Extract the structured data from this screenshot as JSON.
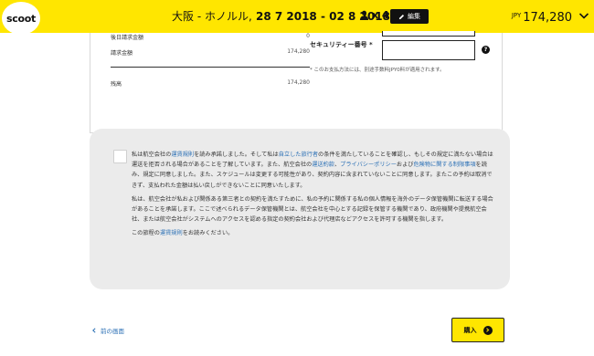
{
  "header": {
    "logo": "scoot",
    "route": "大阪 - ホノルル,",
    "dates": "28 7 2018 - 02 8 2018",
    "passengers": "x 4",
    "edit_label": "編集",
    "currency": "JPY",
    "total": "174,280",
    "bg_color": "#ffe600"
  },
  "summary": {
    "rows": [
      {
        "label": "後日請求金額",
        "value": "0"
      },
      {
        "label": "請求金額",
        "value": "174,280"
      },
      {
        "label": "残高",
        "value": "174,280"
      }
    ],
    "security_code_label": "セキュリティー番号 *",
    "security_code_value": "",
    "fee_note": "* このお支払方法には、別途手数料JPY0料が適用されます。"
  },
  "terms": {
    "p1_a": "私は航空会社の",
    "p1_link1": "運賃規則",
    "p1_b": "を読み承諾しました。そして私は",
    "p1_link2": "自立した旅行者",
    "p1_c": "の条件を満たしていることを確認し、もしその規定に満たない場合は運送を拒否される場合があることを了解しています。また、航空会社の",
    "p1_link3": "運送約款",
    "p1_d": "、",
    "p1_link4": "プライバシーポリシー",
    "p1_e": "および",
    "p1_link5": "危険物に関する制限事項",
    "p1_f": "を読み、規定に同意しました。また、スケジュールは変更する可能性があり、契約内容に含まれていないことに同意します。またこの予約は取消できず、支払われた金額は払い戻しができないことに同意いたします。",
    "p2": "私は、航空会社が私および関係ある第三者との契約を満たすために、私の予約に関係する私の個人情報を海外のデータ保管機関に転送する場合があることを承諾します。ここで述べられるデータ保管機関とは、航空会社を中心とする記録を保管する機関であり、政府機関や提携航空会社、または航空会社がシステムへのアクセスを認める指定の契約会社および代理店などアクセスを許可する機関を指します。",
    "p3_a": "この旅程の",
    "p3_link": "運賃規則",
    "p3_b": "をお読みください。"
  },
  "footer": {
    "back_label": "前の画面",
    "buy_label": "購入"
  }
}
